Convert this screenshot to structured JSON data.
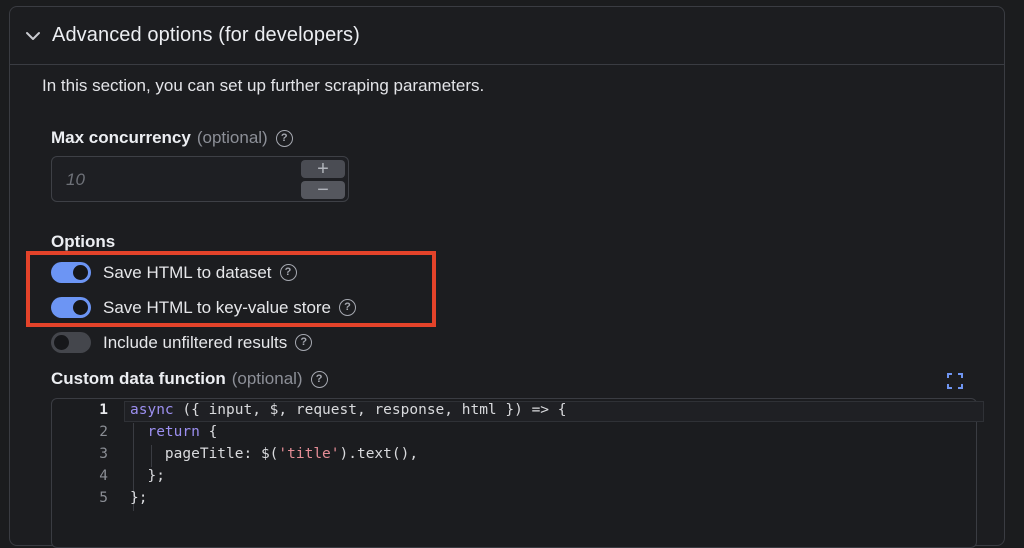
{
  "panel": {
    "title": "Advanced options (for developers)",
    "intro": "In this section, you can set up further scraping parameters."
  },
  "max_concurrency": {
    "label": "Max concurrency",
    "optional": "(optional)",
    "placeholder": "10",
    "increment": "+",
    "decrement": "−"
  },
  "options": {
    "title": "Options",
    "items": [
      {
        "label": "Save HTML to dataset",
        "enabled": true
      },
      {
        "label": "Save HTML to key-value store",
        "enabled": true
      },
      {
        "label": "Include unfiltered results",
        "enabled": false
      }
    ]
  },
  "custom_function": {
    "label": "Custom data function",
    "optional": "(optional)",
    "active_line": 1,
    "line_numbers": [
      "1",
      "2",
      "3",
      "4",
      "5"
    ],
    "lines": [
      [
        {
          "t": "async",
          "c": "kw"
        },
        {
          "t": " ({ input, $, request, response, html }) => {"
        }
      ],
      [
        {
          "t": "  "
        },
        {
          "t": "return",
          "c": "kw"
        },
        {
          "t": " {"
        }
      ],
      [
        {
          "t": "    pageTitle: $("
        },
        {
          "t": "'title'",
          "c": "str"
        },
        {
          "t": ").text(),"
        }
      ],
      [
        {
          "t": "  };"
        }
      ],
      [
        {
          "t": "};"
        }
      ]
    ]
  },
  "colors": {
    "toggle_on": "#6c95f4",
    "highlight_border": "#e3432a",
    "keyword": "#9c8ff0",
    "string": "#e58d96"
  },
  "icons": {
    "collapse": "chevron-down-icon",
    "help": "question-circle-icon",
    "expand_editor": "fullscreen-icon"
  }
}
